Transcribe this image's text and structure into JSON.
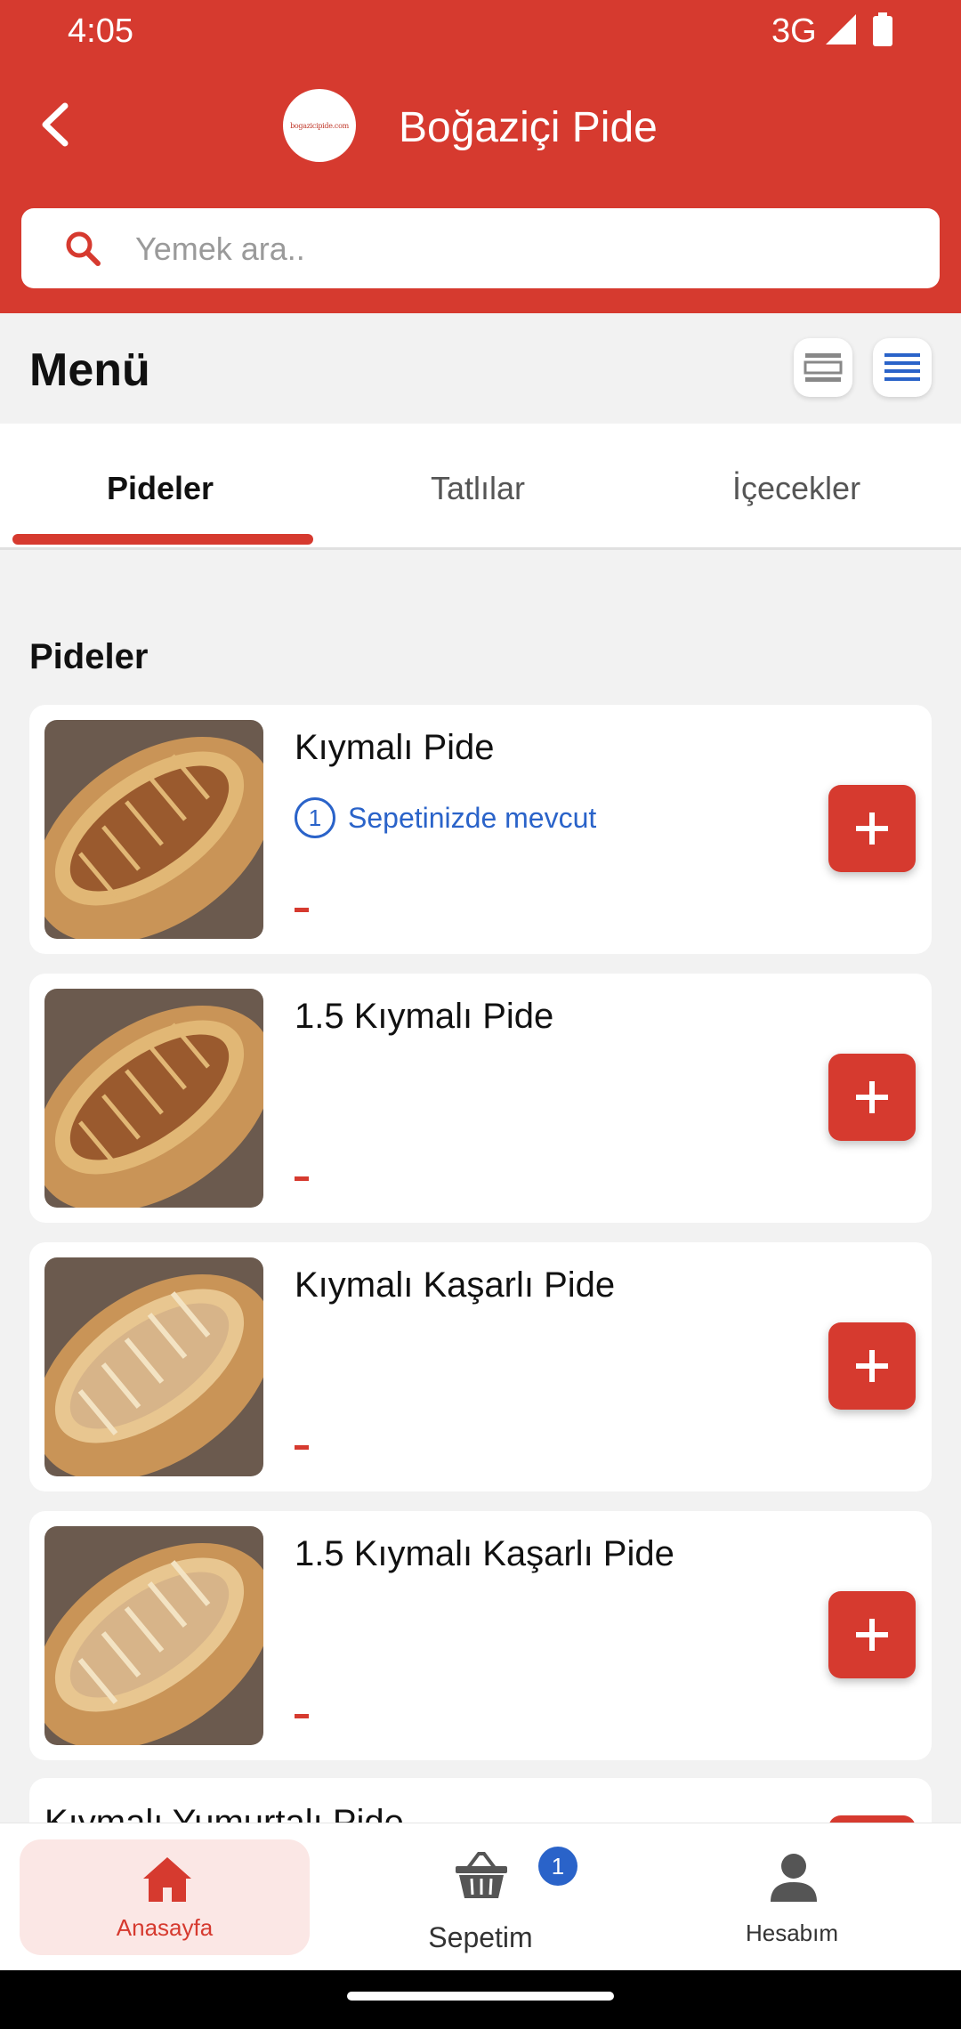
{
  "status_bar": {
    "time": "4:05",
    "network": "3G"
  },
  "header": {
    "title": "Boğaziçi Pide",
    "logo_text": "bogazicipide.com",
    "search_placeholder": "Yemek ara.."
  },
  "menu": {
    "title": "Menü"
  },
  "tabs": [
    {
      "label": "Pideler",
      "active": true
    },
    {
      "label": "Tatlılar",
      "active": false
    },
    {
      "label": "İçecekler",
      "active": false
    }
  ],
  "section": {
    "title": "Pideler"
  },
  "items": [
    {
      "name": "Kıymalı Pide",
      "in_cart_count": "1",
      "in_cart_text": "Sepetinizde mevcut",
      "price": "-"
    },
    {
      "name": "1.5 Kıymalı Pide",
      "price": "-"
    },
    {
      "name": "Kıymalı Kaşarlı Pide",
      "price": "-"
    },
    {
      "name": "1.5 Kıymalı Kaşarlı Pide",
      "price": "-"
    },
    {
      "name": "Kıymalı Yumurtalı Pide"
    }
  ],
  "bottom_nav": {
    "home": "Anasayfa",
    "cart": "Sepetim",
    "cart_count": "1",
    "account": "Hesabım"
  },
  "colors": {
    "primary": "#d63a2f",
    "accent_blue": "#2a63c9"
  },
  "icons": [
    "back-arrow-icon",
    "search-icon",
    "grid-view-icon",
    "list-view-icon",
    "plus-icon",
    "home-icon",
    "basket-icon",
    "user-icon"
  ]
}
